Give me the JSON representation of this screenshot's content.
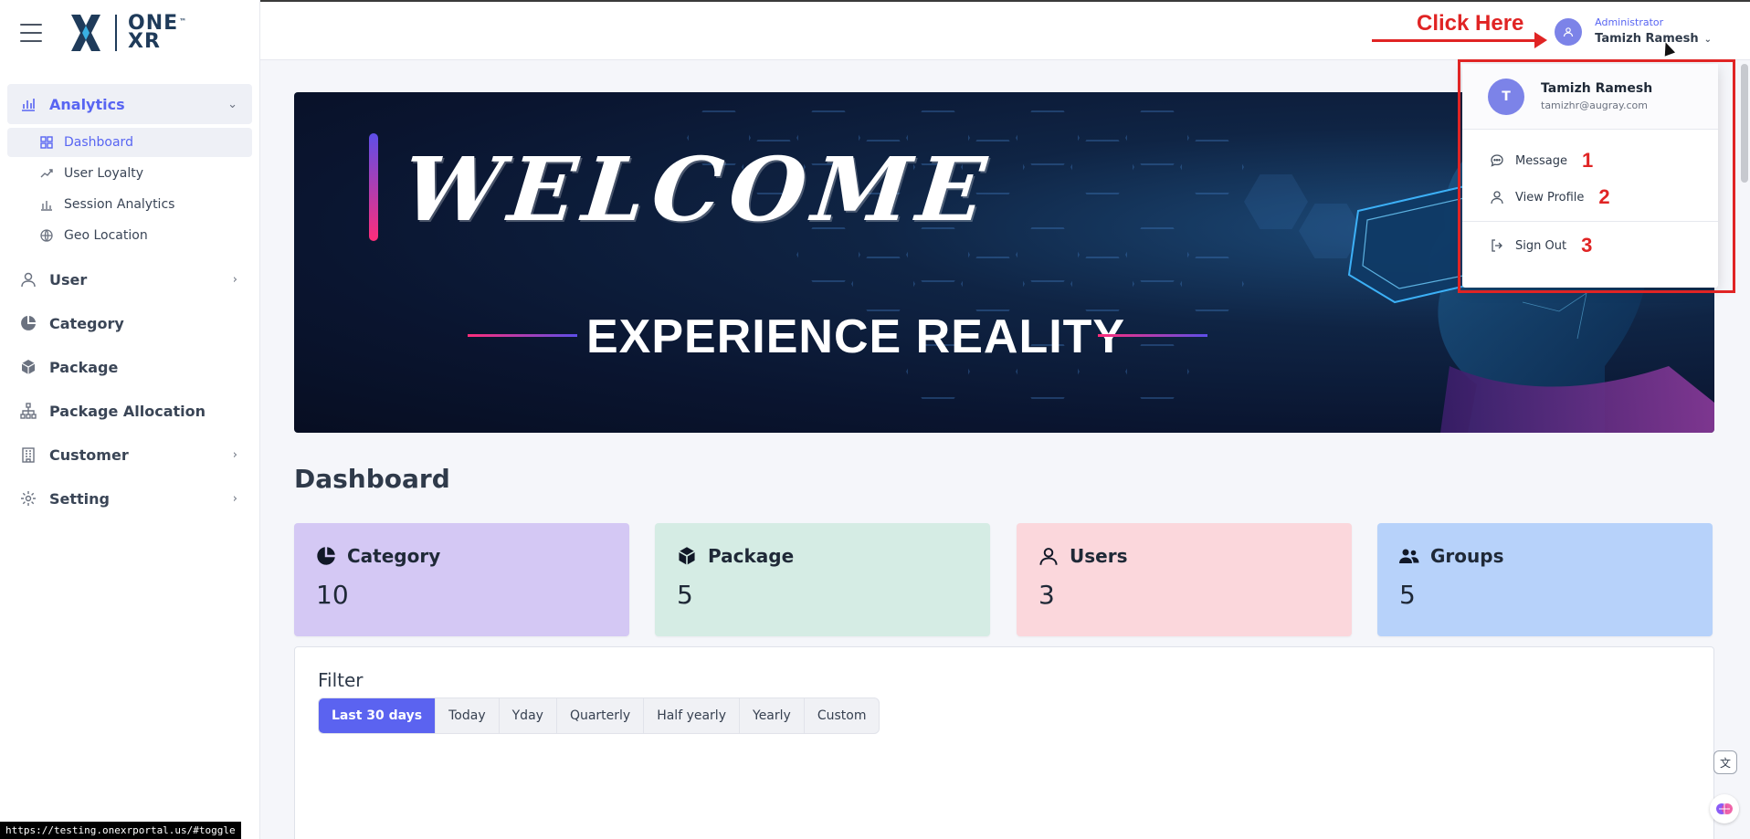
{
  "brand": {
    "logo_text_top": "ONE",
    "logo_text_bottom": "XR",
    "logo_tm": "™"
  },
  "sidebar": {
    "groups": [
      {
        "label": "Analytics",
        "icon": "bar-chart-icon",
        "expanded": true,
        "items": [
          {
            "label": "Dashboard",
            "icon": "grid-icon",
            "active": true
          },
          {
            "label": "User Loyalty",
            "icon": "trend-icon"
          },
          {
            "label": "Session Analytics",
            "icon": "bar-chart-icon"
          },
          {
            "label": "Geo Location",
            "icon": "globe-icon"
          }
        ]
      },
      {
        "label": "User",
        "icon": "user-icon",
        "has_children": true
      },
      {
        "label": "Category",
        "icon": "pie-icon"
      },
      {
        "label": "Package",
        "icon": "box-icon"
      },
      {
        "label": "Package Allocation",
        "icon": "hierarchy-icon"
      },
      {
        "label": "Customer",
        "icon": "building-icon",
        "has_children": true
      },
      {
        "label": "Setting",
        "icon": "gear-icon",
        "has_children": true
      }
    ]
  },
  "topbar": {
    "user_role": "Administrator",
    "user_name": "Tamizh Ramesh",
    "annotation": "Click Here"
  },
  "banner": {
    "headline": "WELCOME",
    "tagline": "EXPERIENCE REALITY"
  },
  "dashboard": {
    "title": "Dashboard",
    "cards": [
      {
        "label": "Category",
        "value": "10",
        "icon": "pie-icon",
        "color": "#d4c8f4"
      },
      {
        "label": "Package",
        "value": "5",
        "icon": "box-icon",
        "color": "#d5ece4"
      },
      {
        "label": "Users",
        "value": "3",
        "icon": "user-icon",
        "color": "#fbd7dc"
      },
      {
        "label": "Groups",
        "value": "5",
        "icon": "users-icon",
        "color": "#b7d2fa"
      }
    ]
  },
  "filter": {
    "title": "Filter",
    "options": [
      "Last 30 days",
      "Today",
      "Yday",
      "Quarterly",
      "Half yearly",
      "Yearly",
      "Custom"
    ],
    "selected": "Last 30 days"
  },
  "dropdown": {
    "name": "Tamizh Ramesh",
    "email": "tamizhr@augray.com",
    "avatar_letter": "T",
    "items": [
      {
        "label": "Message",
        "icon": "chat-icon",
        "annotation": "1"
      },
      {
        "label": "View Profile",
        "icon": "user-icon",
        "annotation": "2"
      },
      {
        "label": "Sign Out",
        "icon": "logout-icon",
        "annotation": "3"
      }
    ]
  },
  "status_bar": {
    "url": "https://testing.onexrportal.us/#toggle"
  },
  "colors": {
    "accent": "#5865f2",
    "annotation": "#e02424",
    "sidebar_bg": "#ffffff"
  }
}
